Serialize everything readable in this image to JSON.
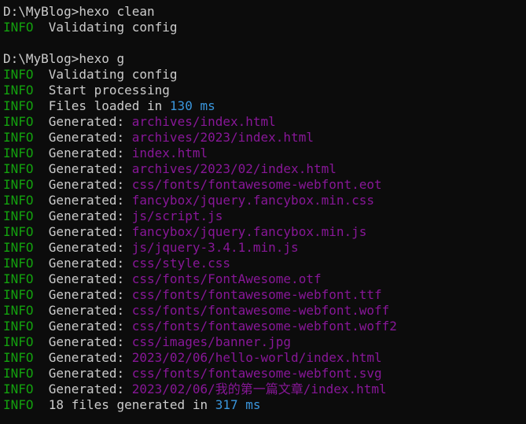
{
  "colors": {
    "background": "#0c0c0c",
    "text": "#cccccc",
    "info_label": "#13a10e",
    "path": "#881798",
    "number": "#3a96dd"
  },
  "lines": [
    {
      "kind": "prompt",
      "prompt": "D:\\MyBlog>",
      "command": "hexo clean"
    },
    {
      "kind": "info",
      "label": "INFO",
      "text": "  Validating config"
    },
    {
      "kind": "blank"
    },
    {
      "kind": "prompt",
      "prompt": "D:\\MyBlog>",
      "command": "hexo g"
    },
    {
      "kind": "info",
      "label": "INFO",
      "text": "  Validating config"
    },
    {
      "kind": "info",
      "label": "INFO",
      "text": "  Start processing"
    },
    {
      "kind": "info_num",
      "label": "INFO",
      "text": "  Files loaded in ",
      "number": "130 ms"
    },
    {
      "kind": "generated",
      "label": "INFO",
      "text": "  Generated: ",
      "path": "archives/index.html"
    },
    {
      "kind": "generated",
      "label": "INFO",
      "text": "  Generated: ",
      "path": "archives/2023/index.html"
    },
    {
      "kind": "generated",
      "label": "INFO",
      "text": "  Generated: ",
      "path": "index.html"
    },
    {
      "kind": "generated",
      "label": "INFO",
      "text": "  Generated: ",
      "path": "archives/2023/02/index.html"
    },
    {
      "kind": "generated",
      "label": "INFO",
      "text": "  Generated: ",
      "path": "css/fonts/fontawesome-webfont.eot"
    },
    {
      "kind": "generated",
      "label": "INFO",
      "text": "  Generated: ",
      "path": "fancybox/jquery.fancybox.min.css"
    },
    {
      "kind": "generated",
      "label": "INFO",
      "text": "  Generated: ",
      "path": "js/script.js"
    },
    {
      "kind": "generated",
      "label": "INFO",
      "text": "  Generated: ",
      "path": "fancybox/jquery.fancybox.min.js"
    },
    {
      "kind": "generated",
      "label": "INFO",
      "text": "  Generated: ",
      "path": "js/jquery-3.4.1.min.js"
    },
    {
      "kind": "generated",
      "label": "INFO",
      "text": "  Generated: ",
      "path": "css/style.css"
    },
    {
      "kind": "generated",
      "label": "INFO",
      "text": "  Generated: ",
      "path": "css/fonts/FontAwesome.otf"
    },
    {
      "kind": "generated",
      "label": "INFO",
      "text": "  Generated: ",
      "path": "css/fonts/fontawesome-webfont.ttf"
    },
    {
      "kind": "generated",
      "label": "INFO",
      "text": "  Generated: ",
      "path": "css/fonts/fontawesome-webfont.woff"
    },
    {
      "kind": "generated",
      "label": "INFO",
      "text": "  Generated: ",
      "path": "css/fonts/fontawesome-webfont.woff2"
    },
    {
      "kind": "generated",
      "label": "INFO",
      "text": "  Generated: ",
      "path": "css/images/banner.jpg"
    },
    {
      "kind": "generated",
      "label": "INFO",
      "text": "  Generated: ",
      "path": "2023/02/06/hello-world/index.html"
    },
    {
      "kind": "generated",
      "label": "INFO",
      "text": "  Generated: ",
      "path": "css/fonts/fontawesome-webfont.svg"
    },
    {
      "kind": "generated",
      "label": "INFO",
      "text": "  Generated: ",
      "path": "2023/02/06/我的第一篇文章/index.html"
    },
    {
      "kind": "info_num",
      "label": "INFO",
      "text": "  18 files generated in ",
      "number": "317 ms"
    }
  ]
}
